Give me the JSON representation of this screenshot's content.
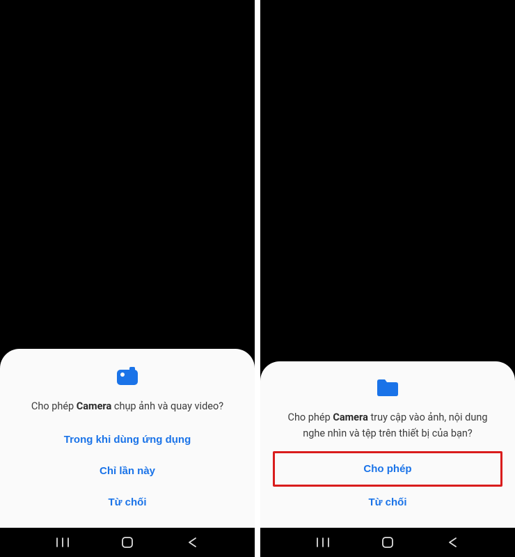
{
  "left": {
    "permission_prefix": "Cho phép ",
    "app_name": "Camera",
    "permission_suffix": " chụp ảnh và quay video?",
    "buttons": {
      "while_using": "Trong khi dùng ứng dụng",
      "only_this_time": "Chỉ lần này",
      "deny": "Từ chối"
    },
    "icon": "camera-icon",
    "accent_color": "#1a73e8"
  },
  "right": {
    "permission_prefix": "Cho phép ",
    "app_name": "Camera",
    "permission_suffix": " truy cập vào ảnh, nội dung nghe nhìn và tệp trên thiết bị của bạn?",
    "buttons": {
      "allow": "Cho phép",
      "deny": "Từ chối"
    },
    "icon": "folder-icon",
    "accent_color": "#1a73e8",
    "highlighted_button": "allow"
  }
}
